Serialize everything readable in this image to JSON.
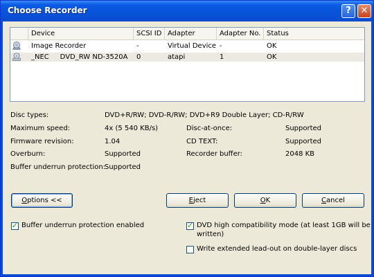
{
  "window": {
    "title": "Choose Recorder",
    "help_glyph": "?",
    "close_glyph": "✕"
  },
  "columns": [
    "Device",
    "SCSI ID",
    "Adapter",
    "Adapter No.",
    "Status"
  ],
  "rows": [
    {
      "device": "Image Recorder",
      "scsi": "-",
      "adapter": "Virtual Device",
      "adapter_no": "-",
      "status": "OK",
      "icon": "image-recorder-icon"
    },
    {
      "device": "_NEC     DVD_RW ND-3520A",
      "scsi": "0",
      "adapter": "atapi",
      "adapter_no": "1",
      "status": "OK",
      "icon": "dvd-drive-icon"
    }
  ],
  "info": {
    "disc_types_label": "Disc types:",
    "disc_types_value": "DVD+R/RW; DVD-R/RW; DVD+R9 Double Layer; CD-R/RW",
    "max_speed_label": "Maximum speed:",
    "max_speed_value": "4x (5 540 KB/s)",
    "firmware_label": "Firmware revision:",
    "firmware_value": "1.04",
    "overburn_label": "Overburn:",
    "overburn_value": "Supported",
    "buffer_label": "Buffer underrun protection:",
    "buffer_value": "Supported",
    "dao_label": "Disc-at-once:",
    "dao_value": "Supported",
    "cdtext_label": "CD TEXT:",
    "cdtext_value": "Supported",
    "recbuf_label": "Recorder buffer:",
    "recbuf_value": "2048 KB"
  },
  "buttons": {
    "options_u": "O",
    "options_rest": "ptions <<",
    "eject_u": "E",
    "eject_rest": "ject",
    "ok_u": "O",
    "ok_rest": "K",
    "cancel_u": "C",
    "cancel_rest": "ancel"
  },
  "checkboxes": {
    "buffer_protection": {
      "label": "Buffer underrun protection enabled",
      "checked": true
    },
    "dvd_compat": {
      "label_line1": "DVD high compatibility mode (at least 1GB will be",
      "label_line2": "written)",
      "checked": true
    },
    "extended_leadout": {
      "label": "Write extended lead-out on double-layer discs",
      "checked": false
    }
  }
}
